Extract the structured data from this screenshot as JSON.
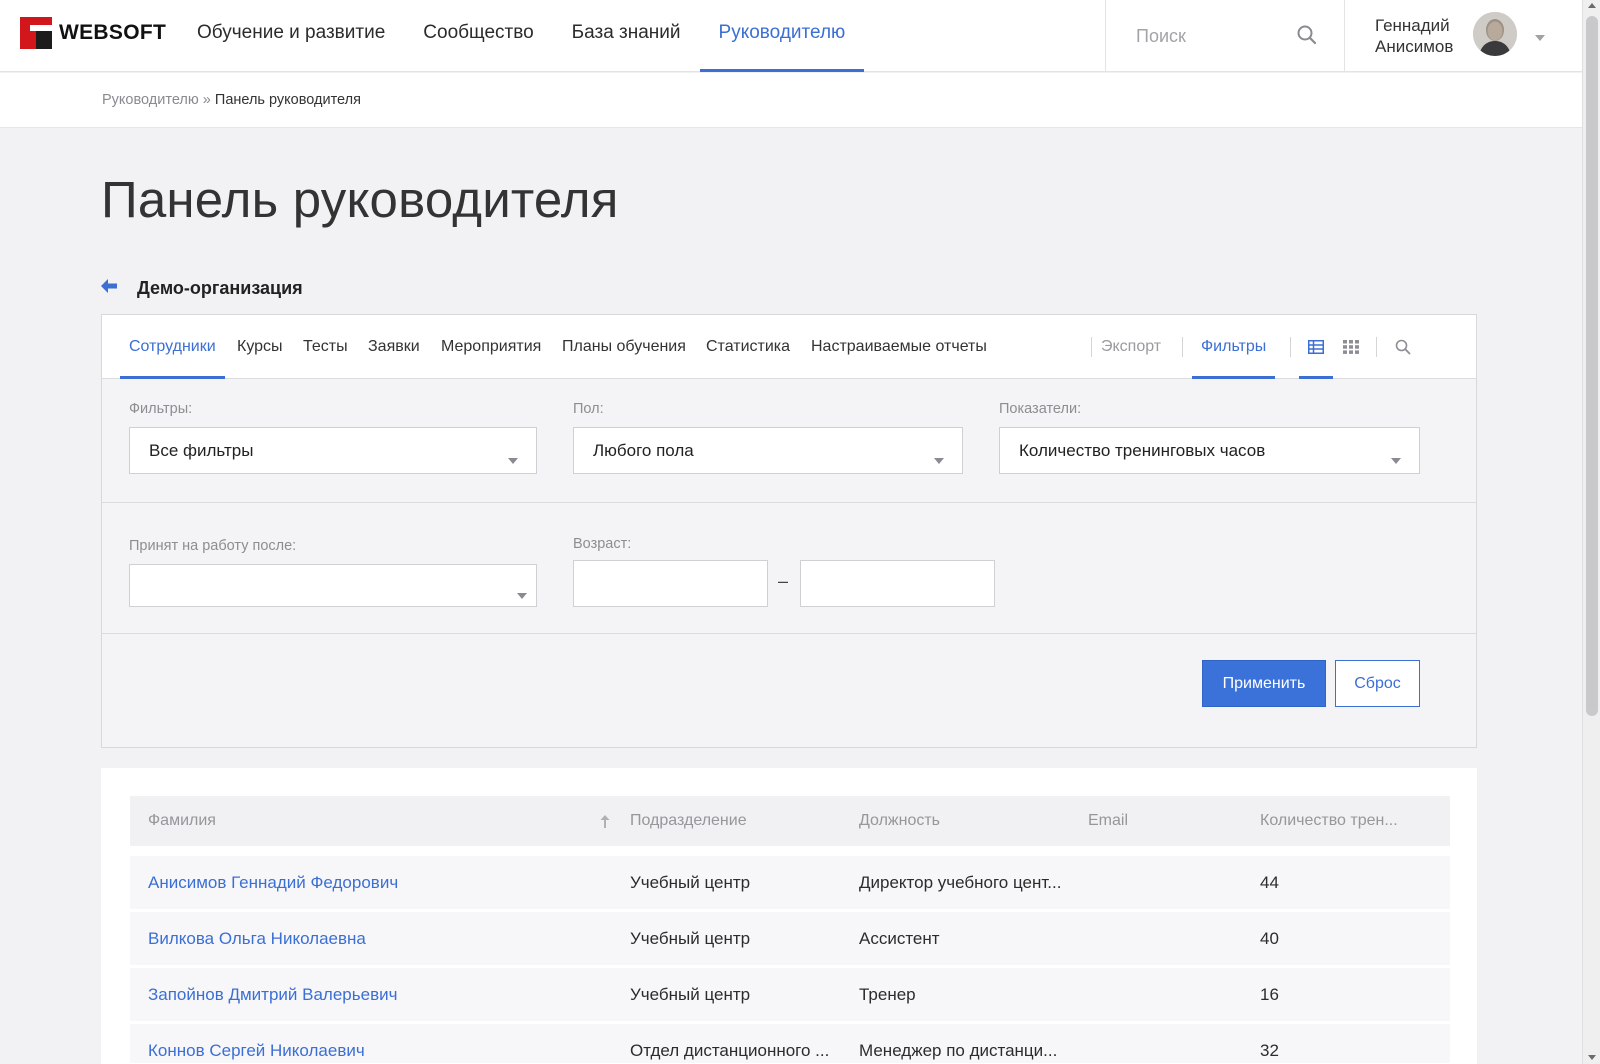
{
  "header": {
    "logo_text": "WEBSOFT",
    "nav": [
      {
        "label": "Обучение и развитие"
      },
      {
        "label": "Сообщество"
      },
      {
        "label": "База знаний"
      },
      {
        "label": "Руководителю"
      }
    ],
    "active_nav": "Руководителю",
    "search_placeholder": "Поиск",
    "user_name_line1": "Геннадий",
    "user_name_line2": "Анисимов"
  },
  "breadcrumb": {
    "parent": "Руководителю",
    "separator": "»",
    "current": "Панель руководителя"
  },
  "page_title": "Панель руководителя",
  "organization": "Демо-организация",
  "tabs": [
    {
      "label": "Сотрудники"
    },
    {
      "label": "Курсы"
    },
    {
      "label": "Тесты"
    },
    {
      "label": "Заявки"
    },
    {
      "label": "Мероприятия"
    },
    {
      "label": "Планы обучения"
    },
    {
      "label": "Статистика"
    },
    {
      "label": "Настраиваемые отчеты"
    }
  ],
  "active_tab": "Сотрудники",
  "toolbar": {
    "export_label": "Экспорт",
    "filters_label": "Фильтры"
  },
  "filters": {
    "filters_label": "Фильтры:",
    "filters_value": "Все фильтры",
    "gender_label": "Пол:",
    "gender_value": "Любого пола",
    "metrics_label": "Показатели:",
    "metrics_value": "Количество тренинговых часов",
    "hired_after_label": "Принят на работу после:",
    "hired_after_value": "",
    "age_label": "Возраст:",
    "age_from": "",
    "age_to": "",
    "age_separator": "–",
    "apply_label": "Применить",
    "reset_label": "Сброс"
  },
  "table": {
    "columns": [
      "Фамилия",
      "Подразделение",
      "Должность",
      "Email",
      "Количество трен..."
    ],
    "sort_column": "Фамилия",
    "rows": [
      {
        "name": "Анисимов Геннадий Федорович",
        "department": "Учебный центр",
        "position": "Директор учебного цент...",
        "email": "",
        "hours": "44"
      },
      {
        "name": "Вилкова Ольга Николаевна",
        "department": "Учебный центр",
        "position": "Ассистент",
        "email": "",
        "hours": "40"
      },
      {
        "name": "Запойнов Дмитрий Валерьевич",
        "department": "Учебный центр",
        "position": "Тренер",
        "email": "",
        "hours": "16"
      },
      {
        "name": "Коннов Сергей Николаевич",
        "department": "Отдел дистанционного ...",
        "position": "Менеджер по дистанци...",
        "email": "",
        "hours": "32"
      }
    ]
  },
  "colors": {
    "accent": "#3b6fd4",
    "primary_button": "#3b72d9",
    "logo_red": "#d1161c"
  }
}
